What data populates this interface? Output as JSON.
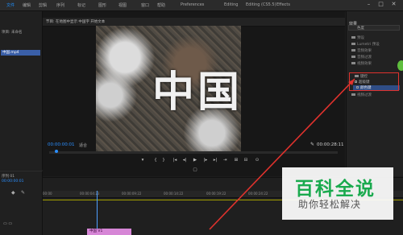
{
  "menubar": {
    "items": [
      "文件",
      "编辑",
      "剪辑",
      "序列",
      "标记",
      "图形",
      "视图",
      "窗口",
      "帮助",
      "Preferences",
      "Editing",
      "Editing (CS5.5)",
      "Effects"
    ]
  },
  "left_panel": {
    "tab": "项目: 未命名",
    "file_item": "中国.mp4",
    "bottom_tab": "序列 01",
    "bottom_label": "00:00:00:01"
  },
  "monitor": {
    "header": "节目: 在地图中显示 中国字 开始文本",
    "video_text": "中国",
    "timecode_current": "00:00:00:01",
    "fit": "适合",
    "timecode_total": "00:00:28:11",
    "controls": [
      "▾",
      "{",
      "}",
      "|◂",
      "◂|",
      "▶",
      "|▸",
      "▸|",
      "⇥",
      "⊞",
      "⊟",
      "⊙",
      "▢"
    ]
  },
  "effects": {
    "header": "效果",
    "search": "色度",
    "tree": [
      "预设",
      "Lumetri 预设",
      "音频效果",
      "音频过渡",
      "视频效果",
      "键控",
      "超级键",
      "视频过渡"
    ],
    "highlighted_item": "颜色键"
  },
  "timeline": {
    "ticks": [
      "00:00",
      "00:00:04:23",
      "00:00:09:22",
      "00:00:14:22",
      "00:00:19:22",
      "00:00:24:22"
    ],
    "clip_label": "中国 V1"
  },
  "watermark": {
    "title": "百科全说",
    "subtitle": "助你轻松解决"
  },
  "colors": {
    "accent": "#2b8fff",
    "annotation_red": "#e0322d",
    "watermark_green": "#1aaa4e",
    "clip_pink": "#d686d6"
  }
}
